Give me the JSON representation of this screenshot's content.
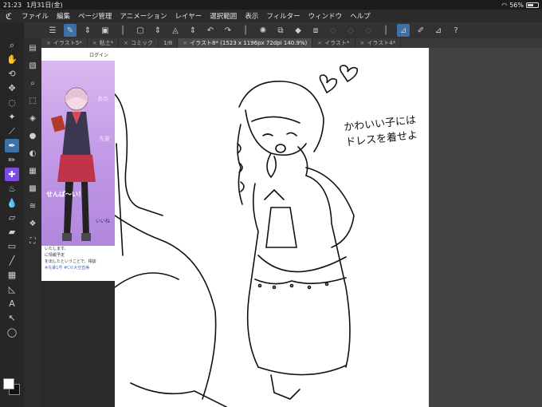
{
  "status": {
    "time": "21:23",
    "date": "1月31日(金)",
    "battery": "56%",
    "battery_level": 0.56
  },
  "menu": [
    "ファイル",
    "編集",
    "ページ管理",
    "アニメーション",
    "レイヤー",
    "選択範囲",
    "表示",
    "フィルター",
    "ウィンドウ",
    "ヘルプ"
  ],
  "tabs": [
    {
      "label": "イラスト5*",
      "active": false
    },
    {
      "label": "粘土*",
      "active": false
    },
    {
      "label": "コミック",
      "active": false
    },
    {
      "label": "1/8",
      "active": false
    },
    {
      "label": "イラスト8* (1523 x 1196px 72dpi 140.9%)",
      "active": true
    },
    {
      "label": "イラスト*",
      "active": false
    },
    {
      "label": "イラスト4*",
      "active": false
    }
  ],
  "reference": {
    "login": "ログイン",
    "caption": "せんぱ〜い！",
    "like": "いいね",
    "text_line1": "いたします。",
    "text_line2": "に情報予定",
    "text_line3": "を出したということで、相談",
    "links": "#先輩1号  #CV:大空直美"
  },
  "canvas": {
    "note_line1": "かわいい子には",
    "note_line2": "ドレスを着せよ",
    "hearts": "♡ ♥"
  },
  "colors": {
    "accent": "#3d6fa8",
    "violet": "#7c4be0"
  }
}
